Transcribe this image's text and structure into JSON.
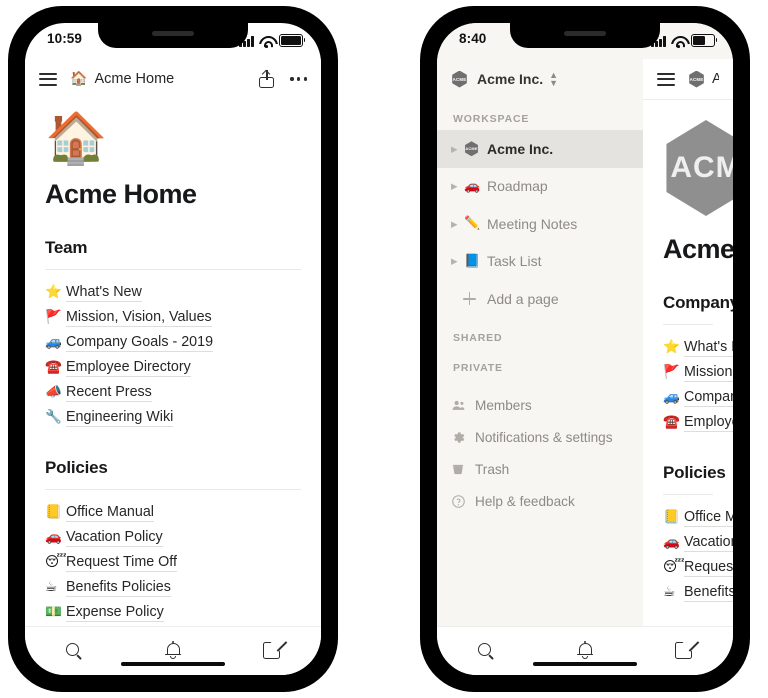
{
  "phone1": {
    "status": {
      "time": "10:59",
      "signal_icon": "signal-bars-icon",
      "wifi_icon": "wifi-icon",
      "battery_icon": "battery-icon"
    },
    "header": {
      "menu_icon": "hamburger-menu-icon",
      "emoji": "🏠",
      "title": "Acme Home",
      "share_icon": "share-icon",
      "more_icon": "more-options-icon"
    },
    "page": {
      "cover_emoji": "🏠",
      "title": "Acme Home",
      "sections": [
        {
          "heading": "Team",
          "items": [
            {
              "emoji": "⭐",
              "label": "What's New"
            },
            {
              "emoji": "🚩",
              "label": "Mission, Vision, Values"
            },
            {
              "emoji": "🚙",
              "label": "Company Goals - 2019"
            },
            {
              "emoji": "☎️",
              "label": "Employee Directory"
            },
            {
              "emoji": "📣",
              "label": "Recent Press"
            },
            {
              "emoji": "🔧",
              "label": "Engineering Wiki"
            }
          ]
        },
        {
          "heading": "Policies",
          "items": [
            {
              "emoji": "📒",
              "label": "Office Manual"
            },
            {
              "emoji": "🚗",
              "label": "Vacation Policy"
            },
            {
              "emoji": "😴",
              "label": "Request Time Off"
            },
            {
              "emoji": "☕",
              "label": "Benefits Policies"
            },
            {
              "emoji": "💵",
              "label": "Expense Policy"
            }
          ]
        }
      ]
    },
    "tabbar": [
      {
        "icon": "search-icon",
        "name": "search"
      },
      {
        "icon": "bell-icon",
        "name": "notifications"
      },
      {
        "icon": "compose-icon",
        "name": "compose"
      }
    ]
  },
  "phone2": {
    "status": {
      "time": "8:40",
      "signal_icon": "signal-bars-icon",
      "wifi_icon": "wifi-icon",
      "battery_icon": "battery-icon"
    },
    "sidebar": {
      "workspace_logo_text": "ACME",
      "workspace_name": "Acme Inc.",
      "switcher_icon": "chevron-updown-icon",
      "caption_workspace": "WORKSPACE",
      "caption_shared": "SHARED",
      "caption_private": "PRIVATE",
      "pages": [
        {
          "emoji": "",
          "label": "Acme Inc.",
          "selected": true,
          "logo": true
        },
        {
          "emoji": "🚗",
          "label": "Roadmap",
          "selected": false,
          "logo": false
        },
        {
          "emoji": "✏️",
          "label": "Meeting Notes",
          "selected": false,
          "logo": false
        },
        {
          "emoji": "📘",
          "label": "Task List",
          "selected": false,
          "logo": false
        }
      ],
      "add_page_label": "Add a page",
      "utilities": [
        {
          "icon": "members-icon",
          "label": "Members"
        },
        {
          "icon": "gear-icon",
          "label": "Notifications & settings"
        },
        {
          "icon": "trash-icon",
          "label": "Trash"
        },
        {
          "icon": "help-icon",
          "label": "Help & feedback"
        }
      ]
    },
    "page": {
      "header": {
        "menu_icon": "hamburger-menu-icon",
        "title": "Acme"
      },
      "cover_logo_text": "ACM",
      "title": "Acme",
      "sections": [
        {
          "heading": "Company",
          "items": [
            {
              "emoji": "⭐",
              "label": "What's N"
            },
            {
              "emoji": "🚩",
              "label": "Mission,"
            },
            {
              "emoji": "🚙",
              "label": "Company"
            },
            {
              "emoji": "☎️",
              "label": "Employe"
            }
          ]
        },
        {
          "heading": "Policies",
          "items": [
            {
              "emoji": "📒",
              "label": "Office Ma"
            },
            {
              "emoji": "🚗",
              "label": "Vacation"
            },
            {
              "emoji": "😴",
              "label": "Request"
            },
            {
              "emoji": "☕",
              "label": "Benefits"
            }
          ]
        }
      ]
    },
    "tabbar": [
      {
        "icon": "search-icon",
        "name": "search"
      },
      {
        "icon": "bell-icon",
        "name": "notifications"
      },
      {
        "icon": "compose-icon",
        "name": "compose"
      }
    ]
  },
  "colors": {
    "sidebar_bg": "#f7f6f3",
    "selected_row": "#e4e3e0",
    "text": "#262625",
    "muted": "#8e8b85"
  }
}
